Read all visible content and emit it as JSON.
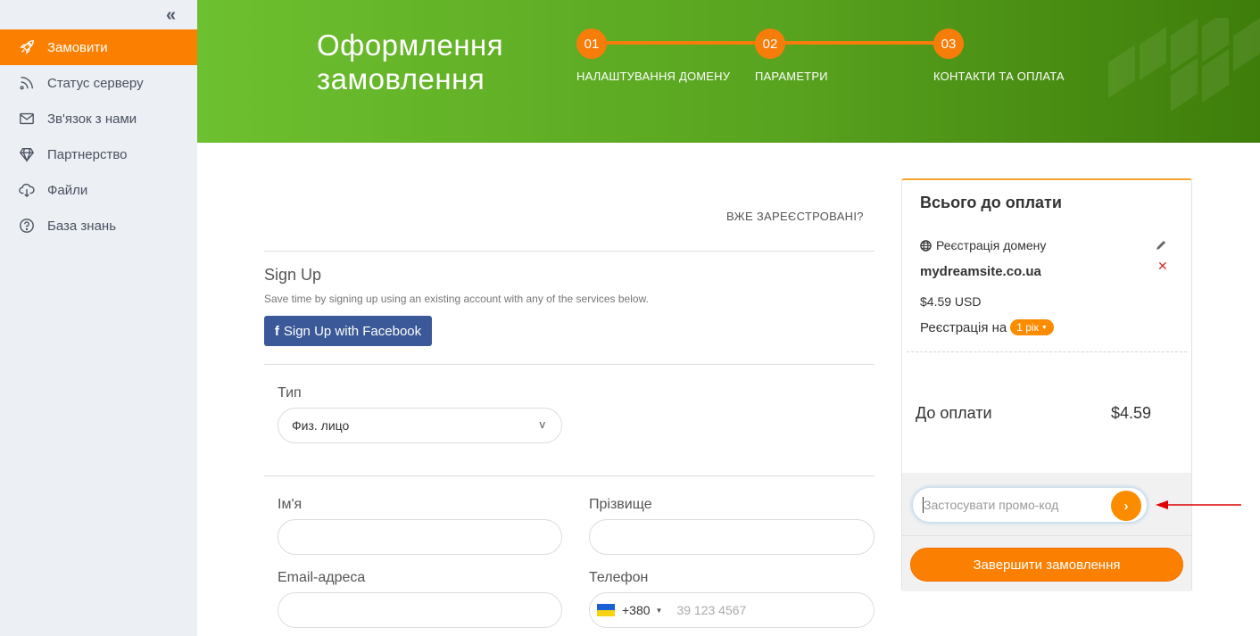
{
  "sidebar": {
    "items": [
      {
        "label": "Замовити",
        "icon": "rocket-icon",
        "active": true
      },
      {
        "label": "Статус серверу",
        "icon": "rss-icon"
      },
      {
        "label": "Зв'язок з нами",
        "icon": "envelope-icon"
      },
      {
        "label": "Партнерство",
        "icon": "diamond-icon"
      },
      {
        "label": "Файли",
        "icon": "cloud-download-icon"
      },
      {
        "label": "База знань",
        "icon": "question-circle-icon"
      }
    ]
  },
  "header": {
    "title": "Оформлення замовлення",
    "steps": [
      {
        "number": "01",
        "label": "НАЛАШТУВАННЯ ДОМЕНУ"
      },
      {
        "number": "02",
        "label": "ПАРАМЕТРИ"
      },
      {
        "number": "03",
        "label": "КОНТАКТИ ТА ОПЛАТА"
      }
    ]
  },
  "form": {
    "already_registered": "ВЖЕ ЗАРЕЄСТРОВАНІ?",
    "signup_title": "Sign Up",
    "signup_sub": "Save time by signing up using an existing account with any of the services below.",
    "facebook_label": "Sign Up with Facebook",
    "type_label": "Тип",
    "type_value": "Физ. лицо",
    "type_arrow": "v",
    "first_name_label": "Ім'я",
    "last_name_label": "Прізвище",
    "email_label": "Email-адреса",
    "phone_label": "Телефон",
    "phone_code": "+380",
    "phone_placeholder": "39 123 4567"
  },
  "summary": {
    "title": "Всього до оплати",
    "item_name": "Реєстрація домену",
    "domain": "mydreamsite.co.ua",
    "price": "$4.59 USD",
    "period_label": "Реєстрація на",
    "period_value": "1 рік",
    "total_label": "До оплати",
    "total_value": "$4.59",
    "promo_placeholder": "Застосувати промо-код",
    "promo_go": "›",
    "submit_label": "Завершити замовлення"
  },
  "colors": {
    "accent": "#fb7f00",
    "header_green": "#58a31f",
    "facebook": "#3b5998",
    "annotation_arrow": "#e00000"
  }
}
